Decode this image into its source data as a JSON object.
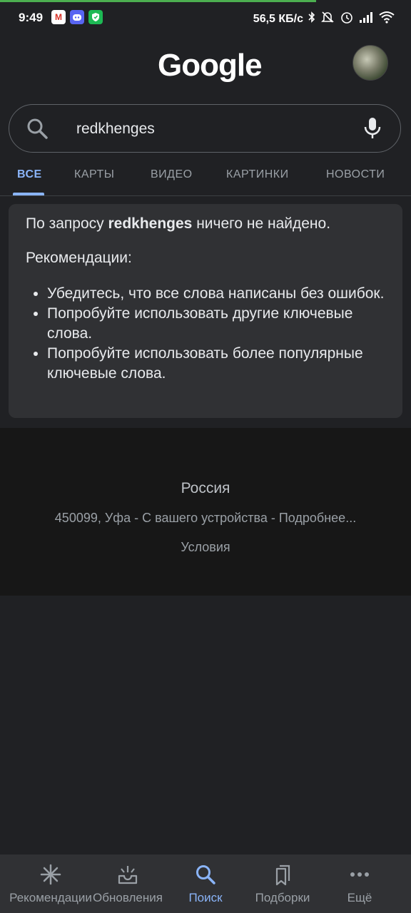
{
  "status_bar": {
    "time": "9:49",
    "network_speed": "56,5 КБ/с",
    "notification_icons": [
      "gmail-icon",
      "discord-icon",
      "vpn-shield-icon"
    ],
    "system_icons": [
      "bluetooth-icon",
      "mute-icon",
      "alarm-icon",
      "signal-icon",
      "wifi-icon"
    ]
  },
  "header": {
    "logo": "Google"
  },
  "search": {
    "query": "redkhenges"
  },
  "tabs": [
    {
      "label": "ВСЕ",
      "active": true
    },
    {
      "label": "КАРТЫ",
      "active": false
    },
    {
      "label": "ВИДЕО",
      "active": false
    },
    {
      "label": "КАРТИНКИ",
      "active": false
    },
    {
      "label": "НОВОСТИ",
      "active": false
    }
  ],
  "results": {
    "no_results_prefix": "По запросу ",
    "query": "redkhenges",
    "no_results_suffix": " ничего не найдено.",
    "recommendations_title": "Рекомендации:",
    "suggestions": [
      "Убедитесь, что все слова написаны без ошибок.",
      "Попробуйте использовать другие ключевые слова.",
      "Попробуйте использовать более популярные ключевые слова."
    ]
  },
  "footer": {
    "country": "Россия",
    "location": "450099, Уфа - С вашего устройства - Подробнее...",
    "terms": "Условия"
  },
  "bottom_nav": [
    {
      "label": "Рекомендации",
      "icon": "asterisk-icon",
      "active": false
    },
    {
      "label": "Обновления",
      "icon": "updates-inbox-icon",
      "active": false
    },
    {
      "label": "Поиск",
      "icon": "search-icon",
      "active": true
    },
    {
      "label": "Подборки",
      "icon": "collections-icon",
      "active": false
    },
    {
      "label": "Ещё",
      "icon": "more-dots-icon",
      "active": false
    }
  ],
  "colors": {
    "background": "#202124",
    "accent": "#8ab4f8",
    "card": "#303134",
    "footer": "#171717"
  }
}
